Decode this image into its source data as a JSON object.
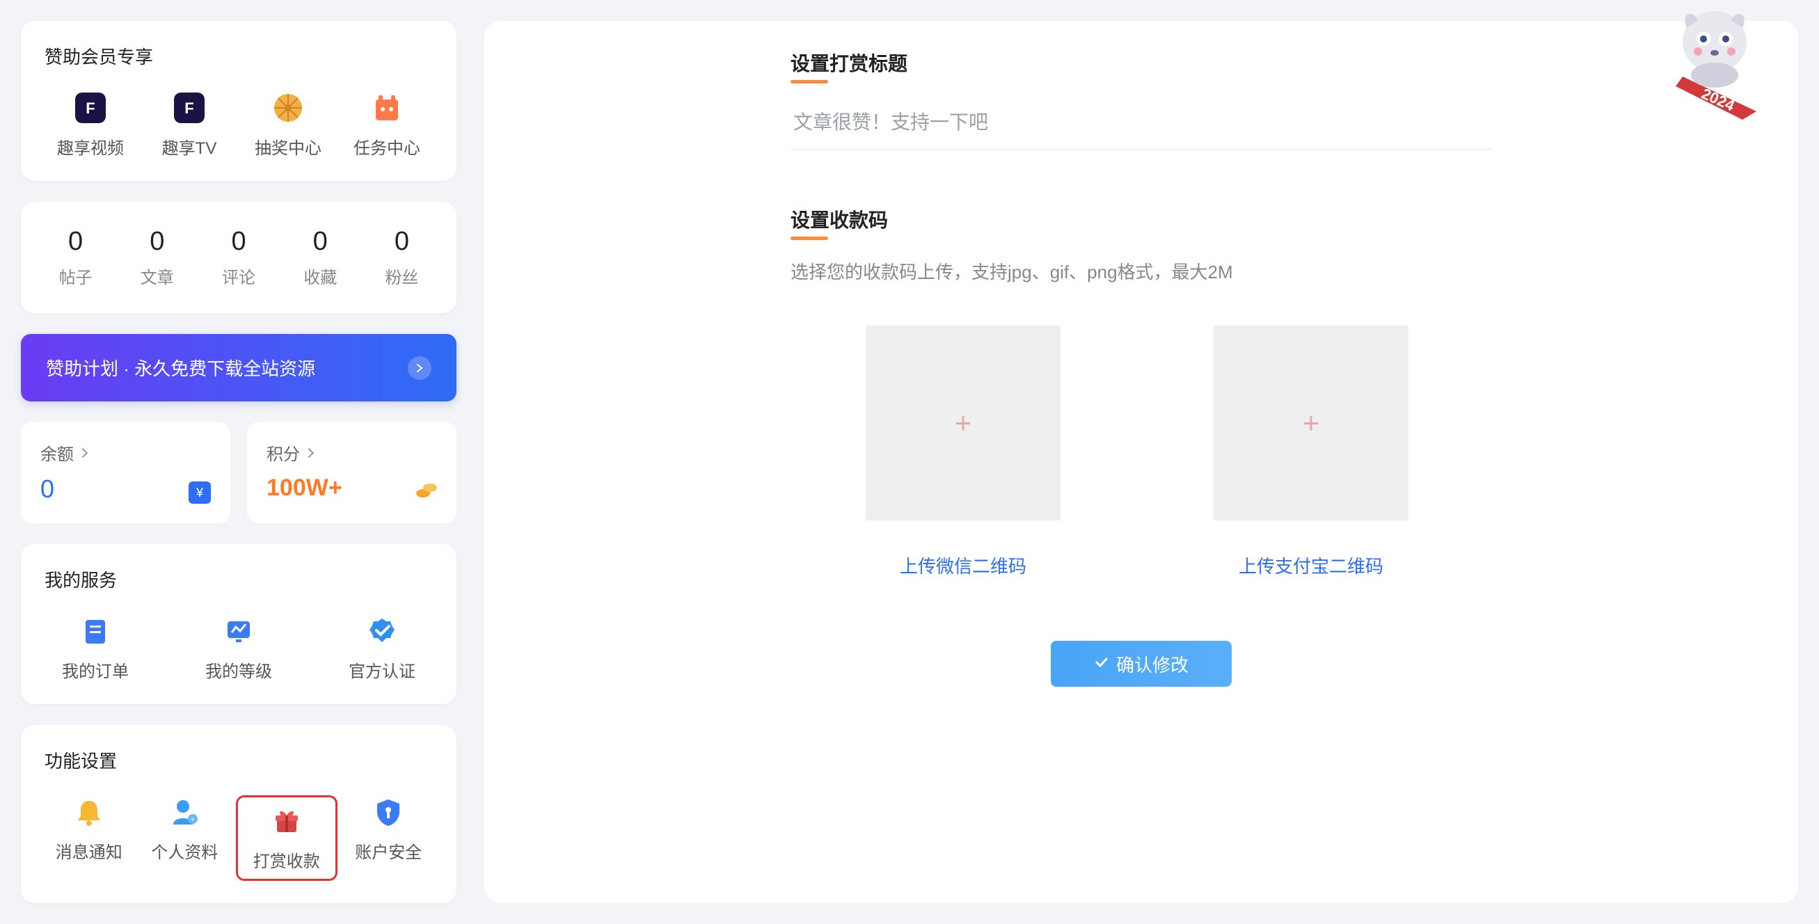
{
  "sidebar": {
    "sponsor_exclusive_title": "赞助会员专享",
    "sponsor_items": [
      {
        "label": "趣享视频"
      },
      {
        "label": "趣享TV"
      },
      {
        "label": "抽奖中心"
      },
      {
        "label": "任务中心"
      }
    ],
    "stats": [
      {
        "value": "0",
        "label": "帖子"
      },
      {
        "value": "0",
        "label": "文章"
      },
      {
        "value": "0",
        "label": "评论"
      },
      {
        "value": "0",
        "label": "收藏"
      },
      {
        "value": "0",
        "label": "粉丝"
      }
    ],
    "sponsor_banner": "赞助计划 · 永久免费下载全站资源",
    "balance_label": "余额",
    "balance_value": "0",
    "points_label": "积分",
    "points_value": "100W+",
    "my_services_title": "我的服务",
    "services": [
      {
        "label": "我的订单"
      },
      {
        "label": "我的等级"
      },
      {
        "label": "官方认证"
      }
    ],
    "settings_title": "功能设置",
    "settings": [
      {
        "label": "消息通知"
      },
      {
        "label": "个人资料"
      },
      {
        "label": "打赏收款"
      },
      {
        "label": "账户安全"
      }
    ]
  },
  "main": {
    "title_section": "设置打赏标题",
    "title_placeholder": "文章很赞！支持一下吧",
    "qrcode_section": "设置收款码",
    "qrcode_desc": "选择您的收款码上传，支持jpg、gif、png格式，最大2M",
    "upload_wechat": "上传微信二维码",
    "upload_alipay": "上传支付宝二维码",
    "confirm": "确认修改"
  },
  "mascot_year": "2024"
}
